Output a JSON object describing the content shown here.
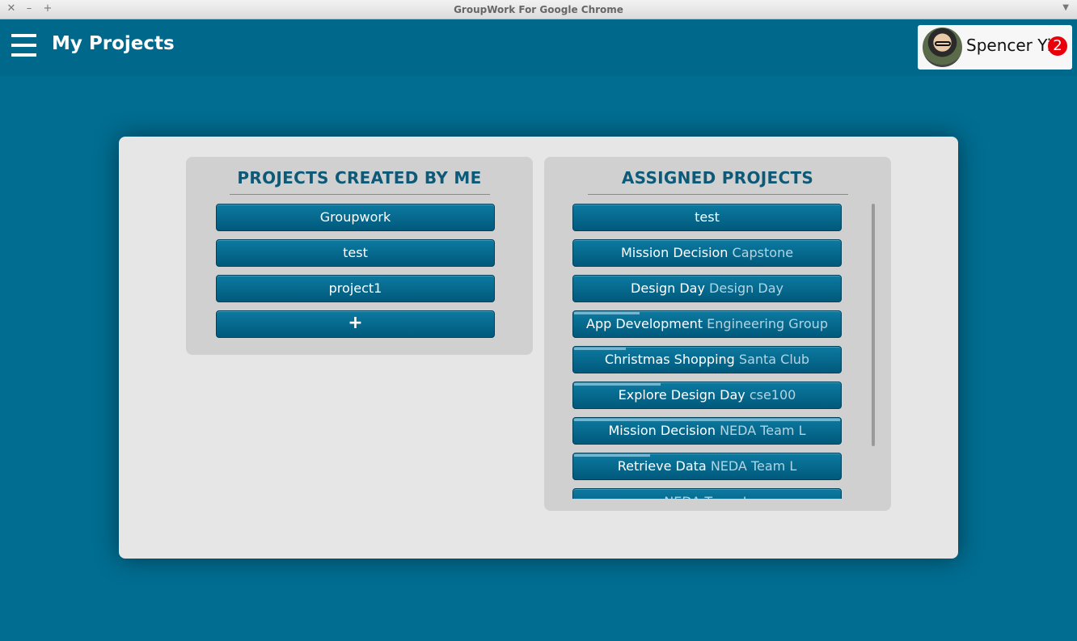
{
  "window": {
    "title": "GroupWork For Google Chrome"
  },
  "header": {
    "title": "My Projects",
    "user_name": "Spencer Yi",
    "notification_count": "2"
  },
  "created_panel": {
    "title": "PROJECTS CREATED BY ME",
    "projects": [
      "Groupwork",
      "test",
      "project1"
    ],
    "add_label": "+"
  },
  "assigned_panel": {
    "title": "ASSIGNED PROJECTS",
    "projects": [
      {
        "name": "test",
        "group": "",
        "progress": 0
      },
      {
        "name": "Mission Decision",
        "group": "Capstone",
        "progress": 0
      },
      {
        "name": "Design Day",
        "group": "Design Day",
        "progress": 0
      },
      {
        "name": "App Development",
        "group": "Engineering Group",
        "progress": 0.25
      },
      {
        "name": "Christmas Shopping",
        "group": "Santa Club",
        "progress": 0.2
      },
      {
        "name": "Explore Design Day",
        "group": "cse100",
        "progress": 0.33
      },
      {
        "name": "Mission Decision",
        "group": "NEDA Team L",
        "progress": 1.0
      },
      {
        "name": "Retrieve Data",
        "group": "NEDA Team L",
        "progress": 0.29
      },
      {
        "name": "",
        "group": "NEDA Team L",
        "progress": 0
      }
    ]
  }
}
